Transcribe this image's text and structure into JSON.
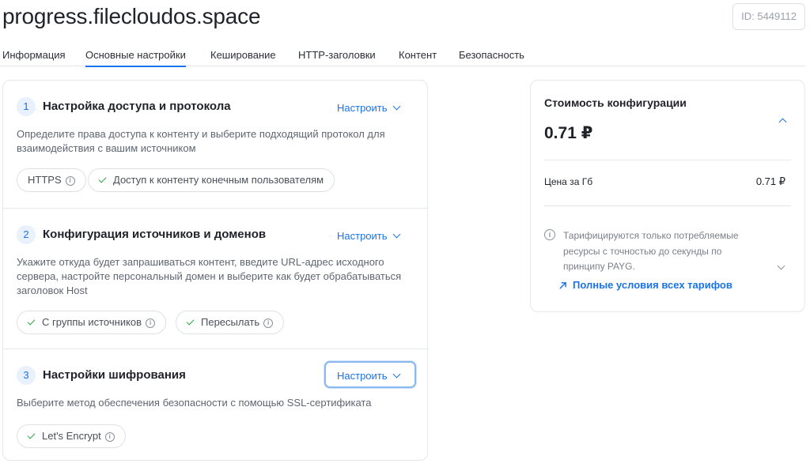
{
  "header": {
    "title": "progress.filecloudos.space",
    "id_badge": "ID: 5449112"
  },
  "tabs": [
    {
      "label": "Информация",
      "active": false
    },
    {
      "label": "Основные настройки",
      "active": true
    },
    {
      "label": "Кеширование",
      "active": false
    },
    {
      "label": "HTTP-заголовки",
      "active": false
    },
    {
      "label": "Контент",
      "active": false
    },
    {
      "label": "Безопасность",
      "active": false
    }
  ],
  "steps": [
    {
      "number": "1",
      "title": "Настройка доступа и протокола",
      "configure_label": "Настроить",
      "description": "Определите права доступа к контенту и выберите подходящий протокол для взаимодействия с вашим источником",
      "chips": [
        {
          "label": "HTTPS",
          "check": false,
          "info": true
        },
        {
          "label": "Доступ к контенту конечным пользователям",
          "check": true,
          "info": false
        }
      ]
    },
    {
      "number": "2",
      "title": "Конфигурация источников и доменов",
      "configure_label": "Настроить",
      "description": "Укажите откуда будет запрашиваться контент, введите URL-адрес исходного сервера, настройте персональный домен и выберите как будет обрабатываться заголовок Host",
      "chips": [
        {
          "label": "С группы источников",
          "check": true,
          "info": true
        },
        {
          "label": "Пересылать",
          "check": true,
          "info": true
        }
      ]
    },
    {
      "number": "3",
      "title": "Настройки шифрования",
      "configure_label": "Настроить",
      "description": "Выберите метод обеспечения безопасности с помощью SSL-сертификата",
      "chips": [
        {
          "label": "Let's Encrypt",
          "check": true,
          "info": true
        }
      ]
    }
  ],
  "cost": {
    "title": "Стоимость конфигурации",
    "total": "0.71 ₽",
    "price_label": "Цена за Гб",
    "price_value": "0.71 ₽",
    "note": "Тарифицируются только потребляемые ресурсы с точностью до секунды по принципу PAYG.",
    "link_label": "Полные условия всех тарифов"
  },
  "colors": {
    "accent": "#1a73e8",
    "check": "#28a745",
    "border": "#e4e7ec"
  },
  "icons": {
    "info": "info-icon",
    "check": "check-icon",
    "chevron_down": "chevron-down-icon",
    "chevron_up": "chevron-up-icon",
    "external_link": "external-link-arrow-icon"
  }
}
